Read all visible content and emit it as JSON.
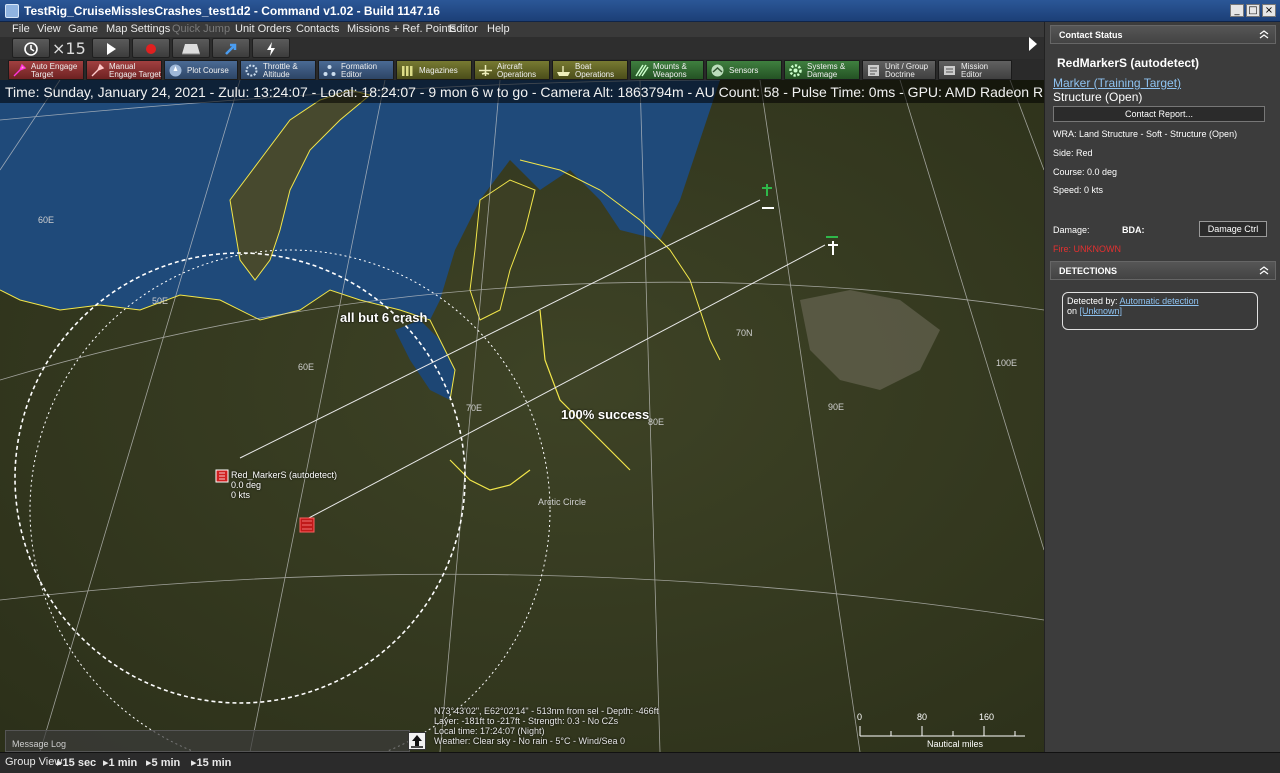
{
  "window": {
    "title": "TestRig_CruiseMisslesCrashes_test1d2 - Command v1.02 - Build 1147.16",
    "minimize": "_",
    "maximize": "□",
    "close": "×"
  },
  "menu": {
    "items": [
      "File",
      "View",
      "Game",
      "Map Settings",
      "Quick Jump",
      "Unit Orders",
      "Contacts",
      "Missions + Ref. Points",
      "Editor",
      "Help"
    ]
  },
  "toolbar1": {
    "speed": "×15",
    "buttons": [
      "clock-icon",
      "play-icon",
      "record-icon",
      "runway-icon",
      "arrow-icon",
      "lightning-icon"
    ]
  },
  "toolbar2": {
    "buttons": [
      {
        "label": "Auto Engage\nTarget",
        "icon": "auto-engage-icon"
      },
      {
        "label": "Manual\nEngage Target",
        "icon": "manual-engage-icon"
      },
      {
        "label": "Plot Course",
        "icon": "plot-course-icon"
      },
      {
        "label": "Throttle &\nAltitude",
        "icon": "throttle-icon"
      },
      {
        "label": "Formation\nEditor",
        "icon": "formation-icon"
      },
      {
        "label": "Magazines",
        "icon": "magazines-icon"
      },
      {
        "label": "Aircraft\nOperations",
        "icon": "aircraft-icon"
      },
      {
        "label": "Boat\nOperations",
        "icon": "boat-icon"
      },
      {
        "label": "Mounts &\nWeapons",
        "icon": "mounts-icon"
      },
      {
        "label": "Sensors",
        "icon": "sensors-icon"
      },
      {
        "label": "Systems &\nDamage",
        "icon": "systems-icon"
      },
      {
        "label": "Unit / Group\nDoctrine",
        "icon": "doctrine-icon"
      },
      {
        "label": "Mission\nEditor",
        "icon": "mission-editor-icon"
      }
    ]
  },
  "status_line": "Time: Sunday, January 24, 2021 - Zulu: 13:24:07 - Local: 18:24:07 - 9 mon 6 w to go -  Camera Alt: 1863794m  - AU Count: 58 - Pulse Time: 0ms - GPU: AMD Radeon R",
  "map": {
    "annotations": [
      "all but 6 crash",
      "100% success"
    ],
    "grid_labels": [
      "60E",
      "50E",
      "60E",
      "70E",
      "80E",
      "90E",
      "100E",
      "70N",
      "Arctic Circle"
    ],
    "unit": {
      "name": "Red_MarkerS (autodetect)",
      "course": "0.0 deg",
      "speed": "0 kts"
    },
    "cursor_info": [
      "N73°43'02\", E62°02'14\" - 513nm from sel - Depth: -466ft",
      "Layer: -181ft to -217ft - Strength: 0.3 - No CZs",
      "Local time: 17:24:07 (Night)",
      "Weather: Clear sky - No rain - 5°C - Wind/Sea 0"
    ],
    "scale": {
      "ticks": [
        "0",
        "80",
        "160"
      ],
      "unit": "Nautical miles"
    },
    "message_log": "Message Log"
  },
  "bottombar": {
    "group_view": "Group View",
    "time_steps": [
      "15 sec",
      "1 min",
      "5 min",
      "15 min"
    ]
  },
  "panel": {
    "contact_status_header": "Contact Status",
    "contact_name": "RedMarkerS (autodetect)",
    "contact_link": "Marker (Training Target)",
    "contact_sub": "Structure (Open)",
    "report_button": "Contact Report...",
    "wra": "WRA: Land Structure - Soft - Structure (Open)",
    "side": "Side: Red",
    "course": "Course: 0.0 deg",
    "speed": "Speed: 0 kts",
    "damage_label": "Damage:",
    "bda_label": "BDA:",
    "damage_ctrl_button": "Damage Ctrl",
    "fire": "Fire: UNKNOWN",
    "detections_header": "DETECTIONS",
    "detected_by_label": "Detected by:",
    "detected_by_value": "Automatic detection",
    "on_label": "on",
    "on_value": "[Unknown]"
  },
  "colors": {
    "titlebar": "#2b5797",
    "panel_bg": "#3c3c3c",
    "link": "#8ec2f0",
    "fire_unknown": "#e53030",
    "coastline": "#f2e64a",
    "sea": "#1f4a7a",
    "land": "#3a3d22"
  }
}
